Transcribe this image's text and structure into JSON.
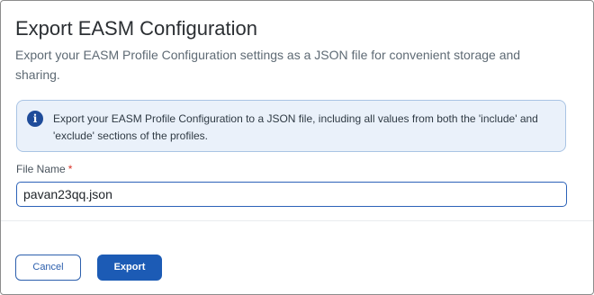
{
  "dialog": {
    "title": "Export EASM Configuration",
    "subtitle": "Export your EASM Profile Configuration settings as a JSON file for convenient storage and sharing."
  },
  "info": {
    "icon": "info-icon",
    "icon_glyph": "i",
    "text": "Export your EASM Profile Configuration to a JSON file, including all values from both the 'include' and 'exclude' sections of the profiles."
  },
  "file_name": {
    "label": "File Name",
    "required_mark": "*",
    "value": "pavan23qq.json"
  },
  "actions": {
    "cancel_label": "Cancel",
    "export_label": "Export"
  },
  "colors": {
    "primary": "#1c5bb5",
    "info_bg": "#eaf1fa",
    "required": "#d93025"
  }
}
